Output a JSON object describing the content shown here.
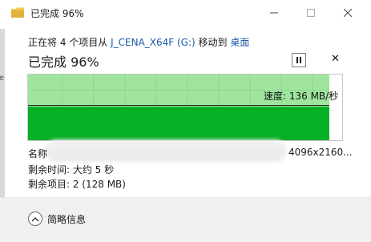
{
  "window": {
    "title": "已完成 96%",
    "left_edge_text": "e"
  },
  "copy": {
    "line_prefix": "正在将 4 个项目从",
    "source": "J_CENA_X64F (G:)",
    "line_middle": "移动到",
    "destination": "桌面",
    "status": "已完成 96%",
    "progress_fraction": 0.96,
    "speed": "速度: 136 MB/秒"
  },
  "details": {
    "name_label": "名称",
    "name_tail": "4096x2160...",
    "time_remaining": "剩余时间: 大约 5 秒",
    "items_remaining": "剩余项目: 2 (128 MB)"
  },
  "footer": {
    "toggle_label": "简略信息",
    "toggle_icon": "chevron-up-icon"
  },
  "colors": {
    "graph_light": "#9fe59f",
    "graph_fill": "#06b025",
    "link": "#1e5aa8",
    "footer_bg": "#f0f0f0"
  }
}
